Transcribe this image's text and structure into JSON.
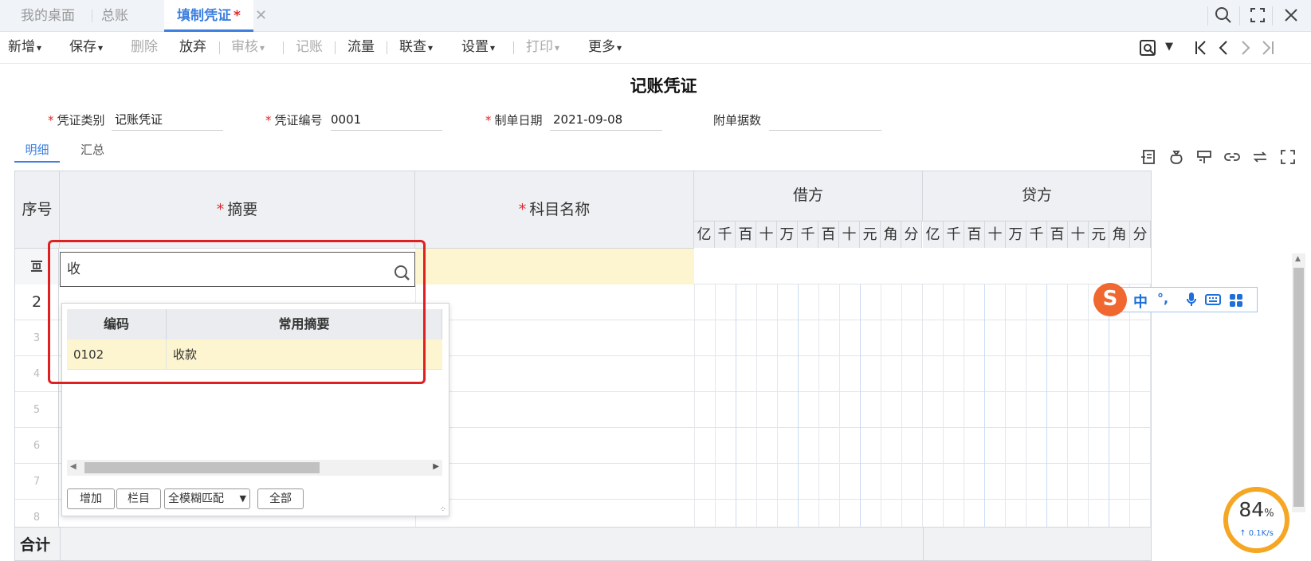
{
  "tabs": [
    {
      "label": "我的桌面"
    },
    {
      "label": "总账"
    },
    {
      "label": "填制凭证",
      "modified": "*"
    }
  ],
  "toolbar": {
    "new": "新增",
    "save": "保存",
    "delete": "删除",
    "discard": "放弃",
    "audit": "审核",
    "post": "记账",
    "flow": "流量",
    "link": "联查",
    "settings": "设置",
    "print": "打印",
    "more": "更多"
  },
  "doc_title": "记账凭证",
  "fields": {
    "category_label": "凭证类别",
    "category_value": "记账凭证",
    "number_label": "凭证编号",
    "number_value": "0001",
    "date_label": "制单日期",
    "date_value": "2021-09-08",
    "attach_label": "附单据数",
    "attach_value": ""
  },
  "subtabs": [
    "明细",
    "汇总"
  ],
  "grid": {
    "col_seq": "序号",
    "col_summary": "摘要",
    "col_account": "科目名称",
    "debit": "借方",
    "credit": "贷方",
    "digits": [
      "亿",
      "千",
      "百",
      "十",
      "万",
      "千",
      "百",
      "十",
      "元",
      "角",
      "分"
    ],
    "rows": [
      "2",
      "3",
      "4",
      "5",
      "6",
      "7",
      "8"
    ],
    "total": "合计"
  },
  "editor": {
    "value": "收"
  },
  "dropdown": {
    "col_code": "编码",
    "col_summary": "常用摘要",
    "rows": [
      {
        "code": "0102",
        "summary": "收款"
      }
    ],
    "btn_add": "增加",
    "btn_columns": "栏目",
    "match_option": "全模糊匹配",
    "btn_all": "全部"
  },
  "ime": {
    "mode": "中",
    "punct": "°,"
  },
  "speed": {
    "percent": "84",
    "unit": "%",
    "rate": "↑ 0.1K/s"
  },
  "colors": {
    "accent": "#3c7fe0",
    "highlight": "#fdf4d0",
    "required": "#e0282c",
    "alert_box": "#e02020"
  }
}
